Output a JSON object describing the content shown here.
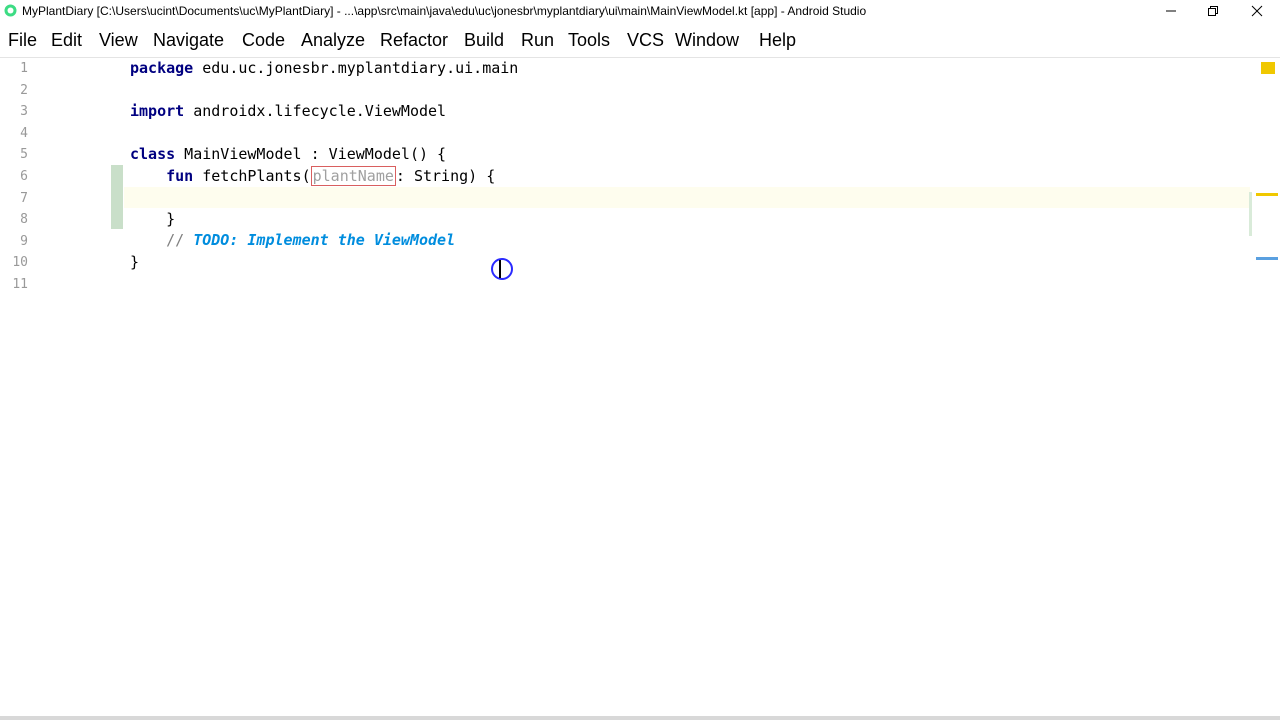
{
  "window": {
    "title": "MyPlantDiary [C:\\Users\\ucint\\Documents\\uc\\MyPlantDiary] - ...\\app\\src\\main\\java\\edu\\uc\\jonesbr\\myplantdiary\\ui\\main\\MainViewModel.kt [app] - Android Studio"
  },
  "menu": [
    "File",
    "Edit",
    "View",
    "Navigate",
    "Code",
    "Analyze",
    "Refactor",
    "Build",
    "Run",
    "Tools",
    "VCS",
    "Window",
    "Help"
  ],
  "editor": {
    "line_numbers": [
      "1",
      "2",
      "3",
      "4",
      "5",
      "6",
      "7",
      "8",
      "9",
      "10",
      "11"
    ],
    "line1": {
      "kw": "package",
      "rest": " edu.uc.jonesbr.myplantdiary.ui.main"
    },
    "line3": {
      "kw": "import",
      "rest": " androidx.lifecycle.ViewModel"
    },
    "line5": {
      "kw": "class",
      "rest": " MainViewModel : ViewModel() {"
    },
    "line6": {
      "indent": "    ",
      "kw": "fun",
      "name": " fetchPlants(",
      "param": "plantName",
      "rest": ": String) {"
    },
    "line8": {
      "text": "    }"
    },
    "line9": {
      "indent": "    ",
      "comment": "// ",
      "todo": "TODO: Implement the ViewModel"
    },
    "line10": {
      "text": "}"
    }
  },
  "colors": {
    "keyword": "#000080",
    "todo": "#008dde",
    "warning_marker": "#f0c800",
    "current_line": "#fefdee"
  }
}
